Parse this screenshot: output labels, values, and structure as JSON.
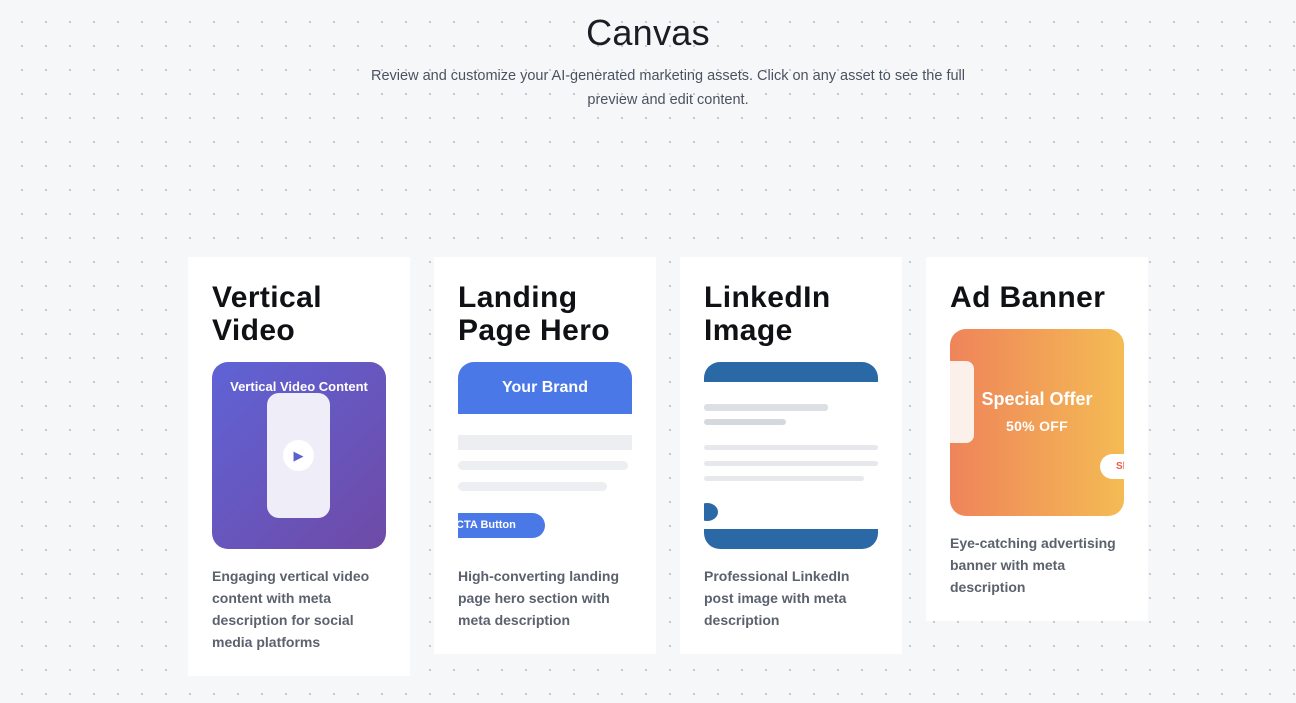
{
  "header": {
    "title": "Canvas",
    "subtitle": "Review and customize your AI-generated marketing assets. Click on any asset to see the full preview and edit content."
  },
  "cards": [
    {
      "title_line1": "Vertical",
      "title_line2": "Video",
      "description": "Engaging vertical video content with meta description for social media platforms",
      "preview": {
        "label": "Vertical Video Content",
        "icon": "play-icon"
      }
    },
    {
      "title_line1": "Landing",
      "title_line2": "Page Hero",
      "description": "High-converting landing page hero section with meta description",
      "preview": {
        "brand": "Your Brand",
        "cta": "CTA Button"
      }
    },
    {
      "title_line1": "LinkedIn",
      "title_line2": "Image",
      "description": "Professional LinkedIn post image with meta description",
      "preview": {}
    },
    {
      "title_line1": "Ad Banner",
      "description": "Eye-catching advertising banner with meta description",
      "preview": {
        "headline": "Special Offer",
        "discount": "50% OFF",
        "button": "Shop Now"
      }
    }
  ],
  "colors": {
    "video_gradient_start": "#5f63d6",
    "video_gradient_end": "#6f4aa6",
    "landing_blue": "#4a78e6",
    "linkedin_blue": "#2b68a6",
    "ad_gradient_start": "#ef845a",
    "ad_gradient_end": "#f4bb54"
  }
}
